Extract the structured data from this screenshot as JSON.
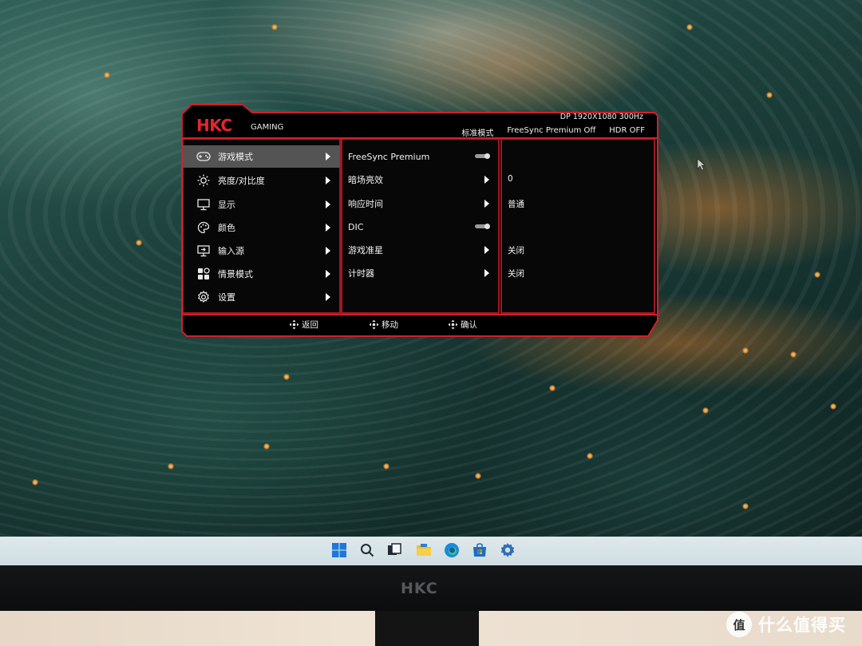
{
  "osd": {
    "brand": "HKC",
    "series": "GAMING",
    "signal": "DP  1920X1080  300Hz",
    "status": {
      "mode": "标准模式",
      "freesync": "FreeSync Premium Off",
      "hdr": "HDR OFF"
    },
    "menu": [
      {
        "label": "游戏模式",
        "icon": "gamepad-icon",
        "selected": true
      },
      {
        "label": "亮度/对比度",
        "icon": "brightness-icon",
        "selected": false
      },
      {
        "label": "显示",
        "icon": "monitor-icon",
        "selected": false
      },
      {
        "label": "颜色",
        "icon": "palette-icon",
        "selected": false
      },
      {
        "label": "输入源",
        "icon": "input-icon",
        "selected": false
      },
      {
        "label": "情景模式",
        "icon": "scene-icon",
        "selected": false
      },
      {
        "label": "设置",
        "icon": "gear-icon",
        "selected": false
      }
    ],
    "submenu": [
      {
        "label": "FreeSync Premium",
        "control": "toggle"
      },
      {
        "label": "暗场亮效",
        "control": "arrow"
      },
      {
        "label": "响应时间",
        "control": "arrow"
      },
      {
        "label": "DIC",
        "control": "toggle"
      },
      {
        "label": "游戏准星",
        "control": "arrow"
      },
      {
        "label": "计时器",
        "control": "arrow"
      }
    ],
    "values": [
      "0",
      "普通",
      "关闭",
      "关闭"
    ],
    "footer": {
      "back": "返回",
      "move": "移动",
      "confirm": "确认"
    },
    "colors": {
      "accent": "#d21f2a",
      "panel": "#000000",
      "selected": "#545454"
    }
  },
  "taskbar": {
    "icons": [
      "windows-start-icon",
      "search-icon",
      "task-view-icon",
      "file-explorer-icon",
      "edge-browser-icon",
      "store-icon",
      "settings-icon"
    ]
  },
  "bezel": {
    "logo": "HKC"
  },
  "watermark": {
    "symbol": "值",
    "text": "什么值得买"
  }
}
